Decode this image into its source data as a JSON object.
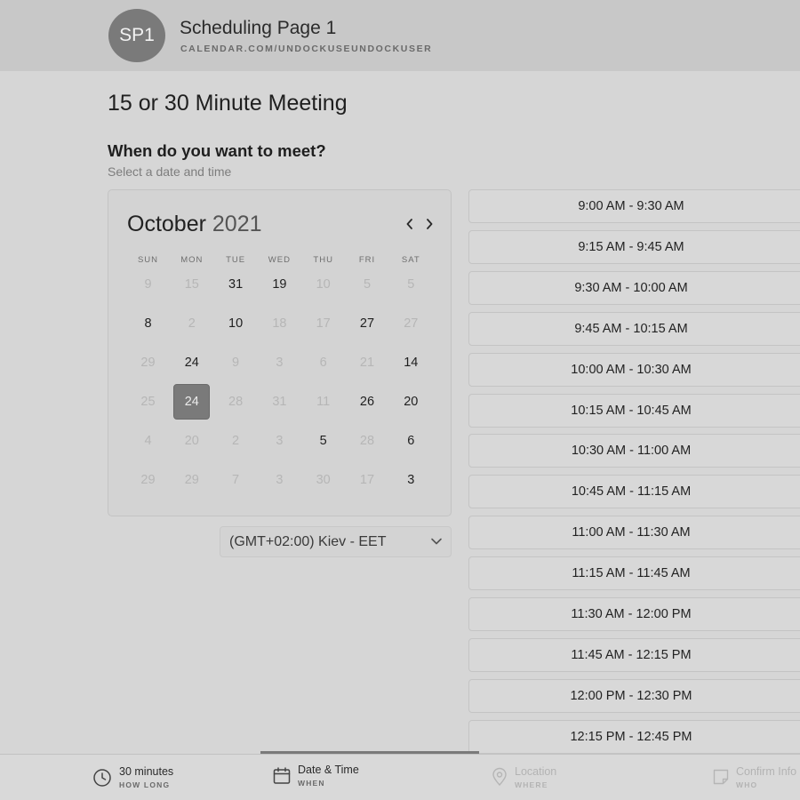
{
  "header": {
    "avatar_initials": "SP1",
    "page_name": "Scheduling Page 1",
    "page_url": "CALENDAR.COM/UNDOCKUSEUNDOCKUSER"
  },
  "meeting_title": "15 or 30 Minute Meeting",
  "question": "When do you want to meet?",
  "subtitle": "Select a date and time",
  "calendar": {
    "month": "October",
    "year": "2021",
    "prev_icon": "chevron-left-icon",
    "next_icon": "chevron-right-icon",
    "weekdays": [
      "SUN",
      "MON",
      "TUE",
      "WED",
      "THU",
      "FRI",
      "SAT"
    ],
    "weeks": [
      [
        {
          "d": "9",
          "s": "off"
        },
        {
          "d": "15",
          "s": "off"
        },
        {
          "d": "31",
          "s": "on"
        },
        {
          "d": "19",
          "s": "on"
        },
        {
          "d": "10",
          "s": "off"
        },
        {
          "d": "5",
          "s": "off"
        },
        {
          "d": "5",
          "s": "off"
        }
      ],
      [
        {
          "d": "8",
          "s": "on"
        },
        {
          "d": "2",
          "s": "off"
        },
        {
          "d": "10",
          "s": "on"
        },
        {
          "d": "18",
          "s": "off"
        },
        {
          "d": "17",
          "s": "off"
        },
        {
          "d": "27",
          "s": "on"
        },
        {
          "d": "27",
          "s": "off"
        }
      ],
      [
        {
          "d": "29",
          "s": "off"
        },
        {
          "d": "24",
          "s": "on"
        },
        {
          "d": "9",
          "s": "off"
        },
        {
          "d": "3",
          "s": "off"
        },
        {
          "d": "6",
          "s": "off"
        },
        {
          "d": "21",
          "s": "off"
        },
        {
          "d": "14",
          "s": "on"
        }
      ],
      [
        {
          "d": "25",
          "s": "off"
        },
        {
          "d": "24",
          "s": "sel"
        },
        {
          "d": "28",
          "s": "off"
        },
        {
          "d": "31",
          "s": "off"
        },
        {
          "d": "11",
          "s": "off"
        },
        {
          "d": "26",
          "s": "on"
        },
        {
          "d": "20",
          "s": "on"
        }
      ],
      [
        {
          "d": "4",
          "s": "off"
        },
        {
          "d": "20",
          "s": "off"
        },
        {
          "d": "2",
          "s": "off"
        },
        {
          "d": "3",
          "s": "off"
        },
        {
          "d": "5",
          "s": "on"
        },
        {
          "d": "28",
          "s": "off"
        },
        {
          "d": "6",
          "s": "on"
        }
      ],
      [
        {
          "d": "29",
          "s": "off"
        },
        {
          "d": "29",
          "s": "off"
        },
        {
          "d": "7",
          "s": "off"
        },
        {
          "d": "3",
          "s": "off"
        },
        {
          "d": "30",
          "s": "off"
        },
        {
          "d": "17",
          "s": "off"
        },
        {
          "d": "3",
          "s": "on"
        }
      ]
    ]
  },
  "timezone": {
    "label": "(GMT+02:00) Kiev - EET",
    "icon": "chevron-down-icon"
  },
  "time_slots": [
    "9:00 AM - 9:30 AM",
    "9:15 AM - 9:45 AM",
    "9:30 AM - 10:00 AM",
    "9:45 AM - 10:15 AM",
    "10:00 AM - 10:30 AM",
    "10:15 AM - 10:45 AM",
    "10:30 AM - 11:00 AM",
    "10:45 AM - 11:15 AM",
    "11:00 AM - 11:30 AM",
    "11:15 AM - 11:45 AM",
    "11:30 AM - 12:00 PM",
    "11:45 AM - 12:15 PM",
    "12:00 PM - 12:30 PM",
    "12:15 PM - 12:45 PM"
  ],
  "steps": [
    {
      "label": "30 minutes",
      "sub": "HOW LONG",
      "icon": "clock-icon",
      "state": "done"
    },
    {
      "label": "Date & Time",
      "sub": "WHEN",
      "icon": "calendar-icon",
      "state": "active"
    },
    {
      "label": "Location",
      "sub": "WHERE",
      "icon": "location-pin-icon",
      "state": "future"
    },
    {
      "label": "Confirm Info",
      "sub": "WHO",
      "icon": "note-icon",
      "state": "future"
    }
  ],
  "colors": {
    "background": "#d6d6d6",
    "header": "#c8c8c8",
    "selected_day": "#7a7a7a",
    "slot_border": "#c4c4c4"
  }
}
